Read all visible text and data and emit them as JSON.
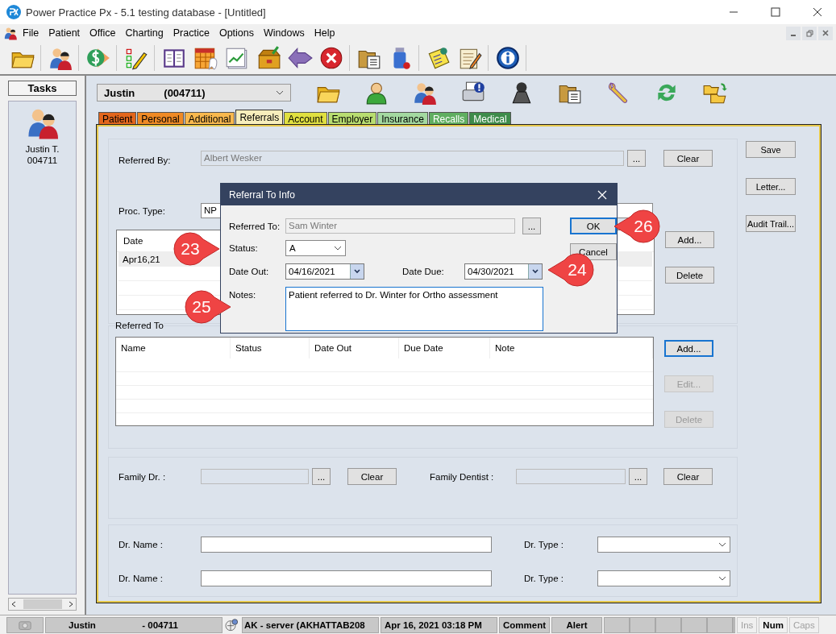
{
  "window": {
    "title": "Power Practice Px - 5.1 testing database - [Untitled]"
  },
  "menu": [
    "File",
    "Patient",
    "Office",
    "Charting",
    "Practice",
    "Options",
    "Windows",
    "Help"
  ],
  "tasks": {
    "title": "Tasks",
    "patient_name": "Justin T.",
    "patient_id": "004711"
  },
  "patient_selector": {
    "name": "Justin",
    "id": "(004711)"
  },
  "tabs": [
    {
      "label": "Patient",
      "selected": false,
      "color": "#e2661c"
    },
    {
      "label": "Personal",
      "selected": false,
      "color": "#ef8a25"
    },
    {
      "label": "Additional",
      "selected": false,
      "color": "#f8b84e"
    },
    {
      "label": "Referrals",
      "selected": true,
      "color": "#f7eebc"
    },
    {
      "label": "Account",
      "selected": false,
      "color": "#e0e040"
    },
    {
      "label": "Employer",
      "selected": false,
      "color": "#b8dd70"
    },
    {
      "label": "Insurance",
      "selected": false,
      "color": "#a3d9a0"
    },
    {
      "label": "Recalls",
      "selected": false,
      "color": "#5fae60"
    },
    {
      "label": "Medical",
      "selected": false,
      "color": "#3e8c4b"
    }
  ],
  "referral_form": {
    "referred_by": {
      "label": "Referred By:",
      "value": "Albert Wesker",
      "disabled": true,
      "browse": "...",
      "clear": "Clear"
    },
    "proc_type": {
      "label": "Proc. Type:",
      "value": "NP"
    },
    "date_list": {
      "column": "Date",
      "rows": [
        {
          "date": "Apr16,21",
          "selected": true
        }
      ]
    },
    "date_buttons": [
      {
        "label": "Add...",
        "disabled": false,
        "focused": false
      },
      {
        "label": "Delete",
        "disabled": false,
        "focused": false
      }
    ],
    "referred_to": {
      "title": "Referred To",
      "columns": [
        "Name",
        "Status",
        "Date Out",
        "Due Date",
        "Note"
      ]
    },
    "referred_to_buttons": [
      {
        "label": "Add...",
        "disabled": false,
        "focused": true
      },
      {
        "label": "Edit...",
        "disabled": true,
        "focused": false
      },
      {
        "label": "Delete",
        "disabled": true,
        "focused": false
      }
    ],
    "family": [
      {
        "label": "Family Dr. :",
        "browse": "...",
        "clear": "Clear"
      },
      {
        "label": "Family Dentist :",
        "browse": "...",
        "clear": "Clear"
      }
    ],
    "doctors": [
      {
        "name_label": "Dr. Name :",
        "type_label": "Dr. Type :"
      },
      {
        "name_label": "Dr. Name :",
        "type_label": "Dr. Type :"
      }
    ],
    "side_buttons": [
      "Save",
      "Letter...",
      "Audit Trail..."
    ]
  },
  "dialog": {
    "title": "Referral To Info",
    "referred_to": {
      "label": "Referred To:",
      "value": "Sam Winter",
      "disabled": true,
      "browse": "..."
    },
    "status": {
      "label": "Status:",
      "value": "A"
    },
    "date_out": {
      "label": "Date Out:",
      "value": "04/16/2021"
    },
    "date_due": {
      "label": "Date Due:",
      "value": "04/30/2021"
    },
    "notes": {
      "label": "Notes:",
      "value": "Patient referred to Dr. Winter for Ortho assessment"
    },
    "buttons": [
      {
        "label": "OK",
        "focused": true
      },
      {
        "label": "Cancel",
        "focused": false
      }
    ]
  },
  "callouts": [
    {
      "number": "23"
    },
    {
      "number": "24"
    },
    {
      "number": "25"
    },
    {
      "number": "26"
    }
  ],
  "status_bar": {
    "user": "Justin",
    "patient_id": "- 004711",
    "server": "AK - server (AKHATTAB208",
    "datetime": "Apr 16, 2021 03:18 PM",
    "cells": [
      "Comment",
      "Alert"
    ],
    "keys": [
      {
        "label": "Ins",
        "on": false
      },
      {
        "label": "Num",
        "on": true
      },
      {
        "label": "Caps",
        "on": false
      }
    ]
  }
}
